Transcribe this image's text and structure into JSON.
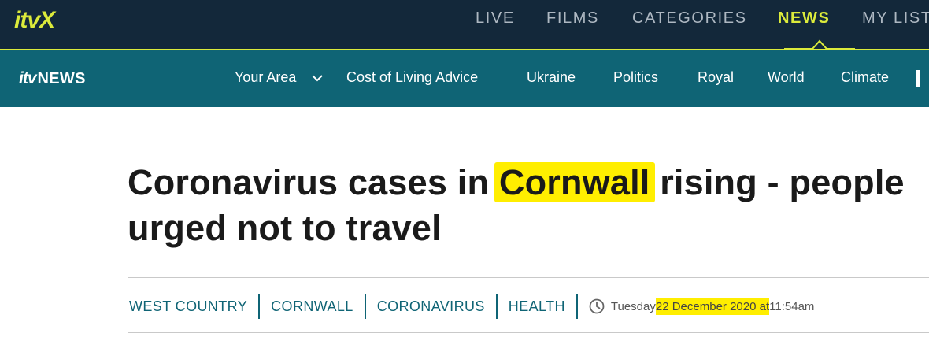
{
  "topbar": {
    "brand": "itvX",
    "nav": [
      {
        "label": "LIVE",
        "active": false
      },
      {
        "label": "FILMS",
        "active": false
      },
      {
        "label": "CATEGORIES",
        "active": false
      },
      {
        "label": "NEWS",
        "active": true
      },
      {
        "label": "MY LIST",
        "active": false
      }
    ]
  },
  "newsbar": {
    "brand_itv": "itv",
    "brand_news": "NEWS",
    "items": [
      {
        "label": "Your Area",
        "has_dropdown": true
      },
      {
        "label": "Cost of Living Advice"
      },
      {
        "label": "Ukraine"
      },
      {
        "label": "Politics"
      },
      {
        "label": "Royal"
      },
      {
        "label": "World"
      },
      {
        "label": "Climate"
      }
    ]
  },
  "article": {
    "headline_before": "Coronavirus cases in ",
    "headline_highlight": "Cornwall",
    "headline_after": " rising - people urged not to travel",
    "tags": [
      "WEST COUNTRY",
      "CORNWALL",
      "CORONAVIRUS",
      "HEALTH"
    ],
    "date_day": "Tuesday ",
    "date_highlight": "22 December 2020 at",
    "date_time": " 11:54am"
  },
  "colors": {
    "topbar_bg": "#13283a",
    "accent": "#dceb3b",
    "newsbar_bg": "#0f6475",
    "highlight": "#ffee00"
  }
}
